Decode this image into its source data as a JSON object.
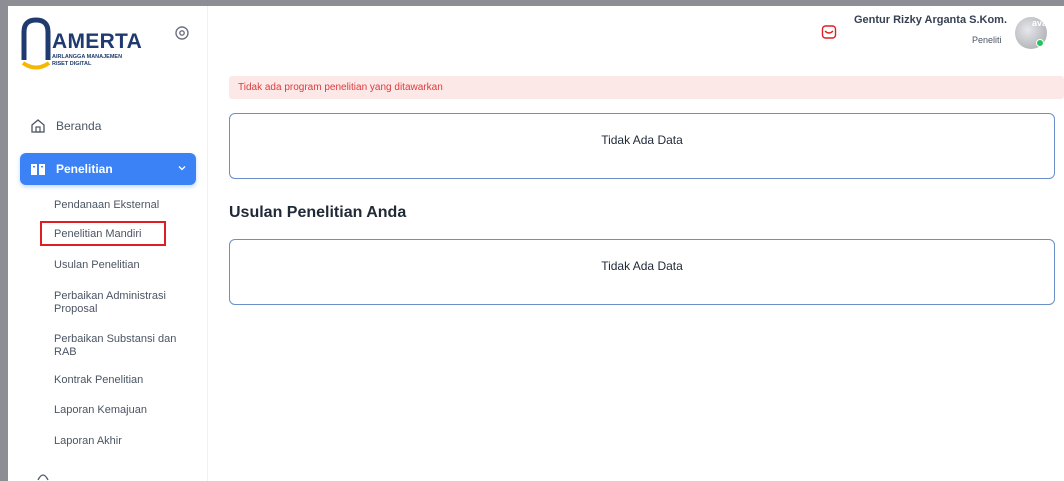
{
  "brand": {
    "title": "AMERTA",
    "subtitle_line1": "AIRLANGGA MANAJEMEN",
    "subtitle_line2": "RISET DIGITAL"
  },
  "sidebar": {
    "items": [
      {
        "label": "Beranda",
        "icon": "home-icon"
      },
      {
        "label": "Penelitian",
        "icon": "book-icon",
        "active": true
      }
    ],
    "submenu": [
      "Pendanaan Eksternal",
      "Penelitian Mandiri",
      "Usulan Penelitian",
      "Perbaikan Administrasi Proposal",
      "Perbaikan Substansi dan RAB",
      "Kontrak Penelitian",
      "Laporan Kemajuan",
      "Laporan Akhir"
    ],
    "highlighted_submenu": "Penelitian Mandiri"
  },
  "header": {
    "user_name": "Gentur Rizky Arganta S.Kom.",
    "user_role": "Peneliti",
    "avatar_text": "ava"
  },
  "main": {
    "alert_text": "Tidak ada program penelitian yang ditawarkan",
    "empty_text_1": "Tidak Ada Data",
    "section_title": "Usulan Penelitian Anda",
    "empty_text_2": "Tidak Ada Data"
  },
  "colors": {
    "primary": "#3b82f6",
    "brand_navy": "#1e3a6e",
    "brand_gold": "#f5b700",
    "alert_bg": "#fde8e8",
    "alert_text": "#dc3c3c",
    "highlight_box": "#e11d24",
    "online": "#22c55e"
  }
}
